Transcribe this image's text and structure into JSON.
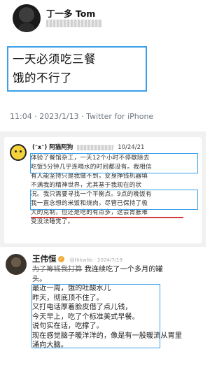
{
  "tweet": {
    "author_name": "丁一多 Tom",
    "lines": [
      "一天必须吃三餐",
      "饿的不行了"
    ],
    "timestamp": "11:04 · 2023/1/13 · Twitter for iPhone"
  },
  "weibo1": {
    "user": "(ᵔᴥᵔ) 阿猫阿狗",
    "date": "10/24/21",
    "lines": [
      "体验了餐馆杂工，一天12个小时不停歇除去",
      "吃饭5分钟几乎连喝水的时间都没有。我相信",
      "有人能坚持只是我做不到，变身挣钱机器填",
      "不满我的精神世界，尤其基于我现在的状",
      "况。我只需要寻找一个平衡点。9点的晚饭有",
      "我一直念想的米饭和烧肉，尽管已保持了极",
      "大的克制，但还是吃的有点多，这会胃胀难",
      "受没法睡觉了。"
    ]
  },
  "weibo2": {
    "user": "王伟恒",
    "meta": "@thkwhb · 2024/7/19",
    "lead_strike": "为了筹钱我打算",
    "lead_rest": "我连续吃了一个多月的罐",
    "lines": [
      "头。",
      "最近一周，饿的吐酸水儿",
      "昨天，彻底顶不住了。",
      "又打电话厚着脸皮借了点儿钱，",
      "今天早上，吃了个标准美式早餐。",
      "说句实在话，吃撑了。",
      "现在感觉脑子暖洋洋的，像是有一股暖流从胃里",
      "涌向大脑。"
    ]
  },
  "colors": {
    "highlight_box": "#3aa0e8",
    "underline": "#d23b3b"
  }
}
